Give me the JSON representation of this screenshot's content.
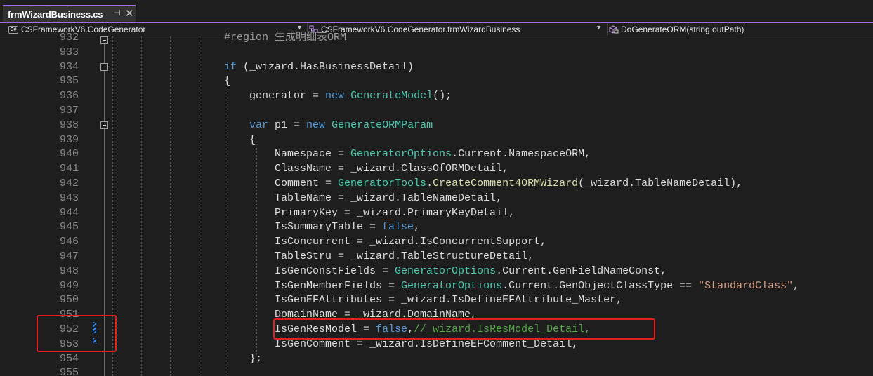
{
  "tab": {
    "title": "frmWizardBusiness.cs",
    "pin_glyph": "⊣",
    "close_glyph": "✕"
  },
  "navbar": {
    "project": "CSFrameworkV6.CodeGenerator",
    "class": "CSFrameworkV6.CodeGenerator.frmWizardBusiness",
    "member": "DoGenerateORM(string outPath)",
    "project_badge": "C#"
  },
  "editor": {
    "line_numbers": [
      "932",
      "933",
      "934",
      "935",
      "936",
      "937",
      "938",
      "939",
      "940",
      "941",
      "942",
      "943",
      "944",
      "945",
      "946",
      "947",
      "948",
      "949",
      "950",
      "951",
      "952",
      "953",
      "954",
      "955"
    ],
    "lines": [
      [
        {
          "t": "#region 生成明细表ORM",
          "c": "rg"
        }
      ],
      [],
      [
        {
          "t": "if",
          "c": "kw"
        },
        {
          "t": " (_wizard.HasBusinessDetail)",
          "c": ""
        }
      ],
      [
        {
          "t": "{",
          "c": ""
        }
      ],
      [
        {
          "t": "    generator = ",
          "c": ""
        },
        {
          "t": "new",
          "c": "kw"
        },
        {
          "t": " ",
          "c": ""
        },
        {
          "t": "GenerateModel",
          "c": "ty"
        },
        {
          "t": "();",
          "c": ""
        }
      ],
      [],
      [
        {
          "t": "    ",
          "c": ""
        },
        {
          "t": "var",
          "c": "kw"
        },
        {
          "t": " p1 = ",
          "c": ""
        },
        {
          "t": "new",
          "c": "kw"
        },
        {
          "t": " ",
          "c": ""
        },
        {
          "t": "GenerateORMParam",
          "c": "ty"
        }
      ],
      [
        {
          "t": "    {",
          "c": ""
        }
      ],
      [
        {
          "t": "        Namespace = ",
          "c": ""
        },
        {
          "t": "GeneratorOptions",
          "c": "ty"
        },
        {
          "t": ".Current.NamespaceORM,",
          "c": ""
        }
      ],
      [
        {
          "t": "        ClassName = _wizard.ClassOfORMDetail,",
          "c": ""
        }
      ],
      [
        {
          "t": "        Comment = ",
          "c": ""
        },
        {
          "t": "GeneratorTools",
          "c": "ty"
        },
        {
          "t": ".",
          "c": ""
        },
        {
          "t": "CreateComment4ORMWizard",
          "c": "mt"
        },
        {
          "t": "(_wizard.TableNameDetail),",
          "c": ""
        }
      ],
      [
        {
          "t": "        TableName = _wizard.TableNameDetail,",
          "c": ""
        }
      ],
      [
        {
          "t": "        PrimaryKey = _wizard.PrimaryKeyDetail,",
          "c": ""
        }
      ],
      [
        {
          "t": "        IsSummaryTable = ",
          "c": ""
        },
        {
          "t": "false",
          "c": "kw"
        },
        {
          "t": ",",
          "c": ""
        }
      ],
      [
        {
          "t": "        IsConcurrent = _wizard.IsConcurrentSupport,",
          "c": ""
        }
      ],
      [
        {
          "t": "        TableStru = _wizard.TableStructureDetail,",
          "c": ""
        }
      ],
      [
        {
          "t": "        IsGenConstFields = ",
          "c": ""
        },
        {
          "t": "GeneratorOptions",
          "c": "ty"
        },
        {
          "t": ".Current.GenFieldNameConst,",
          "c": ""
        }
      ],
      [
        {
          "t": "        IsGenMemberFields = ",
          "c": ""
        },
        {
          "t": "GeneratorOptions",
          "c": "ty"
        },
        {
          "t": ".Current.GenObjectClassType == ",
          "c": ""
        },
        {
          "t": "\"StandardClass\"",
          "c": "st"
        },
        {
          "t": ",",
          "c": ""
        }
      ],
      [
        {
          "t": "        IsGenEFAttributes = _wizard.IsDefineEFAttribute_Master,",
          "c": ""
        }
      ],
      [
        {
          "t": "        DomainName = _wizard.DomainName,",
          "c": ""
        }
      ],
      [
        {
          "t": "        IsGenResModel = ",
          "c": ""
        },
        {
          "t": "false",
          "c": "kw"
        },
        {
          "t": ",",
          "c": ""
        },
        {
          "t": "//_wizard.IsResModel_Detail,",
          "c": "cm"
        }
      ],
      [
        {
          "t": "        IsGenComment = _wizard.IsDefineEFComment_Detail,",
          "c": ""
        }
      ],
      [
        {
          "t": "    };",
          "c": ""
        }
      ],
      []
    ]
  },
  "colors": {
    "accent": "#9c6ded",
    "highlight_box": "#e02020",
    "keyword": "#569cd6",
    "type": "#4ec9b0",
    "method": "#dcdcaa",
    "string": "#d69d85",
    "comment": "#57a64a",
    "change_marker": "#2f8cff"
  }
}
